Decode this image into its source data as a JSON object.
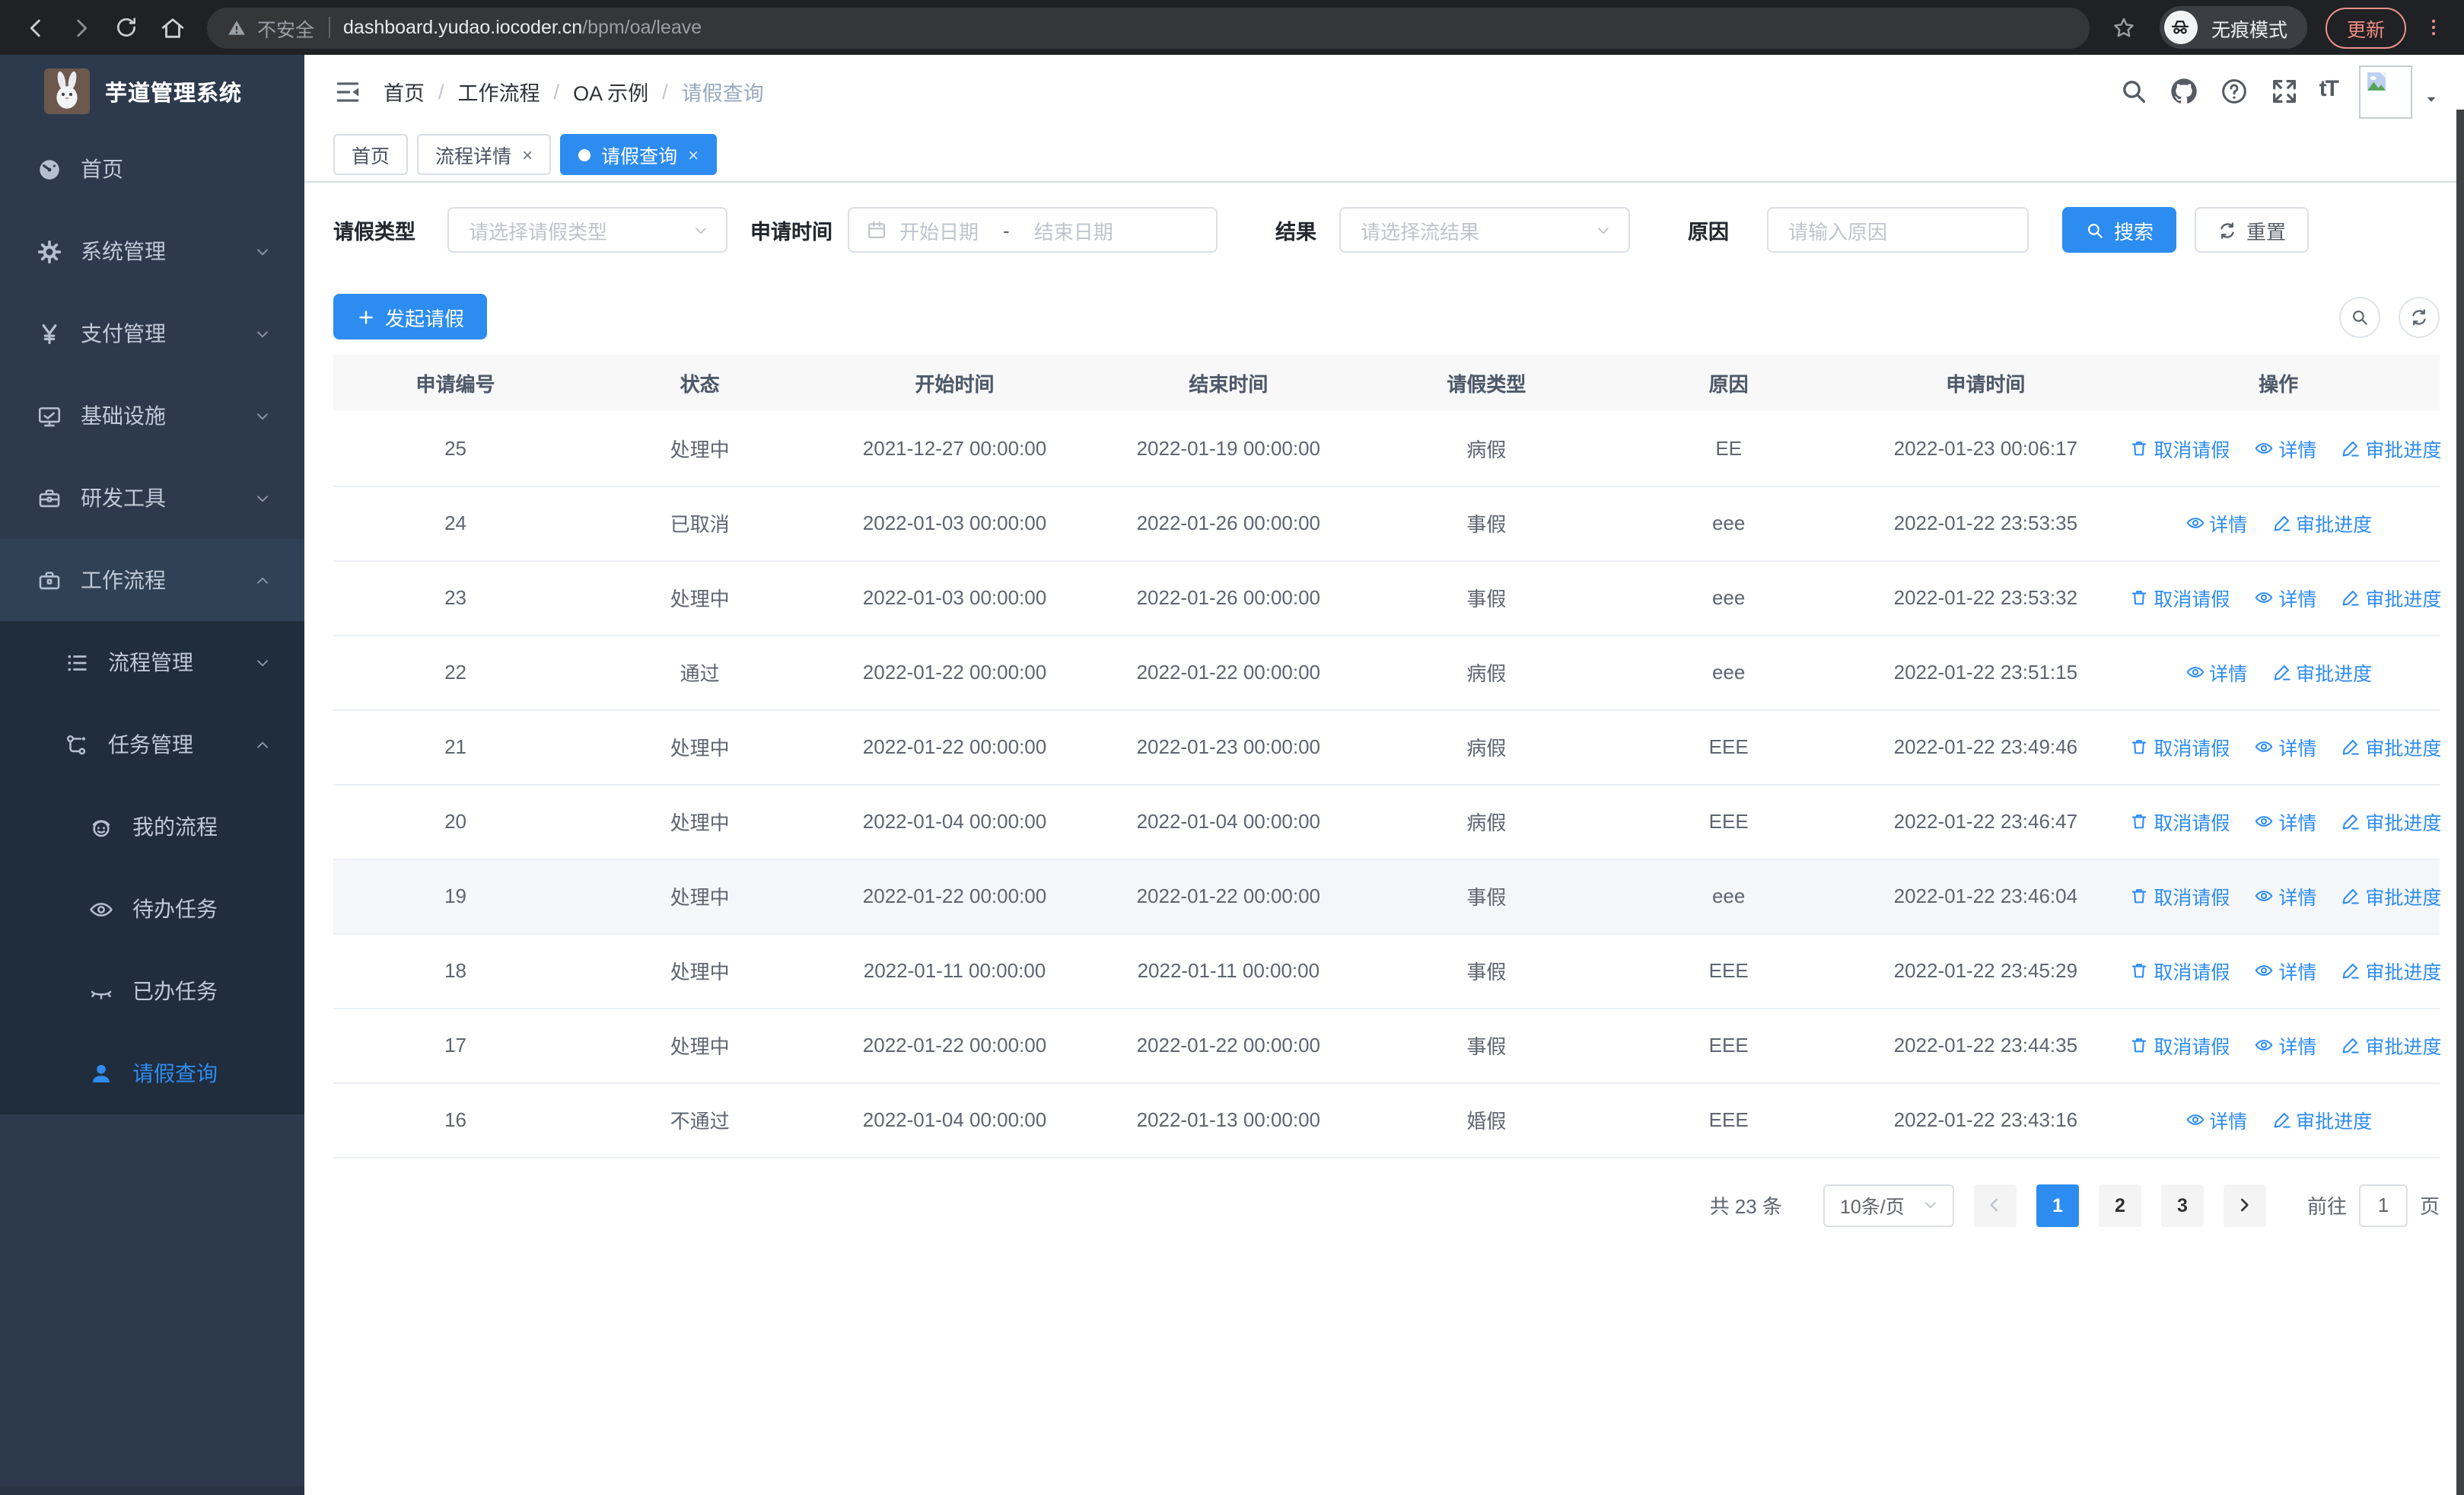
{
  "browser": {
    "security_text": "不安全",
    "url_host": "dashboard.yudao.iocoder.cn",
    "url_path": "/bpm/oa/leave",
    "incognito_label": "无痕模式",
    "update_label": "更新"
  },
  "sidebar": {
    "app_title": "芋道管理系统",
    "items": [
      {
        "key": "home",
        "label": "首页",
        "icon": "gauge-icon",
        "level": 1
      },
      {
        "key": "system",
        "label": "系统管理",
        "icon": "gear-icon",
        "level": 1,
        "chevron": "down"
      },
      {
        "key": "payment",
        "label": "支付管理",
        "icon": "yen-icon",
        "level": 1,
        "chevron": "down"
      },
      {
        "key": "infra",
        "label": "基础设施",
        "icon": "monitor-icon",
        "level": 1,
        "chevron": "down"
      },
      {
        "key": "devtools",
        "label": "研发工具",
        "icon": "toolbox-icon",
        "level": 1,
        "chevron": "down"
      },
      {
        "key": "workflow",
        "label": "工作流程",
        "icon": "briefcase-icon",
        "level": 1,
        "chevron": "up",
        "open": true
      },
      {
        "key": "process-mgmt",
        "label": "流程管理",
        "icon": "list-icon",
        "level": 2,
        "chevron": "down",
        "sub": true
      },
      {
        "key": "task-mgmt",
        "label": "任务管理",
        "icon": "flow-icon",
        "level": 2,
        "chevron": "up",
        "sub": true
      },
      {
        "key": "my-process",
        "label": "我的流程",
        "icon": "robot-icon",
        "level": 3,
        "sub": true
      },
      {
        "key": "todo-tasks",
        "label": "待办任务",
        "icon": "eye-open-icon",
        "level": 3,
        "sub": true
      },
      {
        "key": "done-tasks",
        "label": "已办任务",
        "icon": "eye-closed-icon",
        "level": 3,
        "sub": true
      },
      {
        "key": "leave-query",
        "label": "请假查询",
        "icon": "user-icon",
        "level": 3,
        "sub": true,
        "active": true
      }
    ]
  },
  "header": {
    "breadcrumb": [
      "首页",
      "工作流程",
      "OA 示例",
      "请假查询"
    ]
  },
  "tabs": [
    {
      "label": "首页"
    },
    {
      "label": "流程详情",
      "closable": true
    },
    {
      "label": "请假查询",
      "closable": true,
      "active": true
    }
  ],
  "filters": {
    "type_label": "请假类型",
    "type_placeholder": "请选择请假类型",
    "time_label": "申请时间",
    "start_placeholder": "开始日期",
    "range_separator": "-",
    "end_placeholder": "结束日期",
    "result_label": "结果",
    "result_placeholder": "请选择流结果",
    "reason_label": "原因",
    "reason_placeholder": "请输入原因",
    "search_label": "搜索",
    "reset_label": "重置"
  },
  "toolbar": {
    "create_label": "发起请假"
  },
  "table": {
    "columns": [
      "申请编号",
      "状态",
      "开始时间",
      "结束时间",
      "请假类型",
      "原因",
      "申请时间",
      "操作"
    ],
    "col_widths": [
      "11.6%",
      "11.6%",
      "12.6%",
      "13.4%",
      "11.1%",
      "11.9%",
      "12.5%",
      "15.3%"
    ],
    "action_labels": {
      "cancel": "取消请假",
      "detail": "详情",
      "progress": "审批进度"
    },
    "rows": [
      {
        "id": "25",
        "status": "处理中",
        "start": "2021-12-27 00:00:00",
        "end": "2022-01-19 00:00:00",
        "type": "病假",
        "reason": "EE",
        "apply_time": "2022-01-23 00:06:17",
        "actions": [
          "cancel",
          "detail",
          "progress"
        ]
      },
      {
        "id": "24",
        "status": "已取消",
        "start": "2022-01-03 00:00:00",
        "end": "2022-01-26 00:00:00",
        "type": "事假",
        "reason": "eee",
        "apply_time": "2022-01-22 23:53:35",
        "actions": [
          "detail",
          "progress"
        ]
      },
      {
        "id": "23",
        "status": "处理中",
        "start": "2022-01-03 00:00:00",
        "end": "2022-01-26 00:00:00",
        "type": "事假",
        "reason": "eee",
        "apply_time": "2022-01-22 23:53:32",
        "actions": [
          "cancel",
          "detail",
          "progress"
        ]
      },
      {
        "id": "22",
        "status": "通过",
        "start": "2022-01-22 00:00:00",
        "end": "2022-01-22 00:00:00",
        "type": "病假",
        "reason": "eee",
        "apply_time": "2022-01-22 23:51:15",
        "actions": [
          "detail",
          "progress"
        ]
      },
      {
        "id": "21",
        "status": "处理中",
        "start": "2022-01-22 00:00:00",
        "end": "2022-01-23 00:00:00",
        "type": "病假",
        "reason": "EEE",
        "apply_time": "2022-01-22 23:49:46",
        "actions": [
          "cancel",
          "detail",
          "progress"
        ]
      },
      {
        "id": "20",
        "status": "处理中",
        "start": "2022-01-04 00:00:00",
        "end": "2022-01-04 00:00:00",
        "type": "病假",
        "reason": "EEE",
        "apply_time": "2022-01-22 23:46:47",
        "actions": [
          "cancel",
          "detail",
          "progress"
        ]
      },
      {
        "id": "19",
        "status": "处理中",
        "start": "2022-01-22 00:00:00",
        "end": "2022-01-22 00:00:00",
        "type": "事假",
        "reason": "eee",
        "apply_time": "2022-01-22 23:46:04",
        "actions": [
          "cancel",
          "detail",
          "progress"
        ],
        "highlight": true
      },
      {
        "id": "18",
        "status": "处理中",
        "start": "2022-01-11 00:00:00",
        "end": "2022-01-11 00:00:00",
        "type": "事假",
        "reason": "EEE",
        "apply_time": "2022-01-22 23:45:29",
        "actions": [
          "cancel",
          "detail",
          "progress"
        ]
      },
      {
        "id": "17",
        "status": "处理中",
        "start": "2022-01-22 00:00:00",
        "end": "2022-01-22 00:00:00",
        "type": "事假",
        "reason": "EEE",
        "apply_time": "2022-01-22 23:44:35",
        "actions": [
          "cancel",
          "detail",
          "progress"
        ]
      },
      {
        "id": "16",
        "status": "不通过",
        "start": "2022-01-04 00:00:00",
        "end": "2022-01-13 00:00:00",
        "type": "婚假",
        "reason": "EEE",
        "apply_time": "2022-01-22 23:43:16",
        "actions": [
          "detail",
          "progress"
        ]
      }
    ]
  },
  "pagination": {
    "total_text": "共 23 条",
    "page_size": "10条/页",
    "pages": [
      "1",
      "2",
      "3"
    ],
    "active_page": "1",
    "goto_label": "前往",
    "goto_value": "1",
    "page_unit": "页"
  }
}
